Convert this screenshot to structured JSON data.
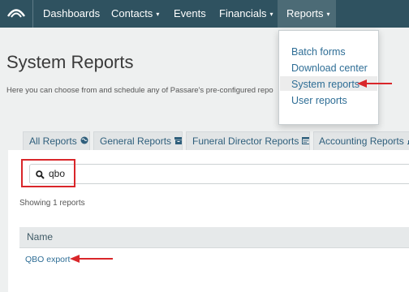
{
  "nav": {
    "logo_icon": "arc-logo-icon",
    "items": [
      {
        "label": "Dashboards"
      },
      {
        "label": "Contacts",
        "caret": "▾"
      },
      {
        "label": "Events"
      },
      {
        "label": "Financials",
        "caret": "▾"
      },
      {
        "label": "Reports",
        "caret": "▾",
        "active": true
      }
    ]
  },
  "page": {
    "title": "System Reports",
    "description": "Here you can choose from and schedule any of Passare's pre-configured repo"
  },
  "reports_menu": {
    "items": [
      {
        "label": "Batch forms"
      },
      {
        "label": "Download center"
      },
      {
        "label": "System reports",
        "highlighted": true
      },
      {
        "label": "User reports"
      }
    ]
  },
  "tabs": [
    {
      "label": "All Reports",
      "icon": "globe-icon"
    },
    {
      "label": "General Reports",
      "icon": "archive-box-icon"
    },
    {
      "label": "Funeral Director Reports",
      "icon": "calendar-icon"
    },
    {
      "label": "Accounting Reports",
      "icon": "bar-chart-icon"
    }
  ],
  "search": {
    "value": "qbo",
    "icon": "search-icon"
  },
  "results": {
    "count_text": "Showing 1 reports",
    "columns": [
      "Name"
    ],
    "rows": [
      {
        "name": "QBO export"
      }
    ]
  },
  "annotations": {
    "color": "#d9262a"
  }
}
